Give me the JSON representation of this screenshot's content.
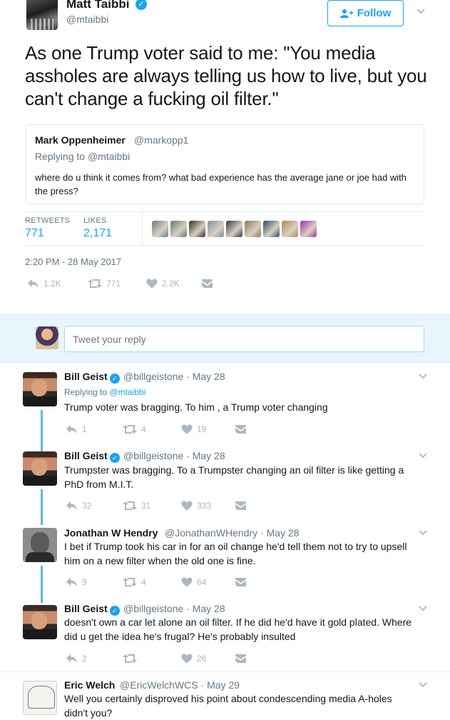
{
  "main": {
    "author_name": "Matt Taibbi",
    "author_handle": "@mtaibbi",
    "follow_label": "Follow",
    "text": "As one Trump voter said to me: \"You media assholes are always telling us how to live, but you can't change a fucking oil filter.\"",
    "quote": {
      "name": "Mark Oppenheimer",
      "handle": "@markopp1",
      "replying_prefix": "Replying to",
      "replying_handle": "@mtaibbi",
      "text": "where do u think it comes from? what bad experience has the average jane or joe had with the press?"
    },
    "stats": {
      "retweets_label": "RETWEETS",
      "retweets_value": "771",
      "likes_label": "LIKES",
      "likes_value": "2,171",
      "liker_colors": [
        "#6b7a8a",
        "#5b7f6a",
        "#3a2a22",
        "#7a8f9e",
        "#2c3a4a",
        "#8a7a50",
        "#2b4a6a",
        "#b08850",
        "#9b2fb0"
      ]
    },
    "timestamp": "2:20 PM - 28 May 2017",
    "actions": {
      "replies": "1.2K",
      "retweets": "771",
      "likes": "2.2K"
    }
  },
  "reply_box": {
    "placeholder": "Tweet your reply"
  },
  "replies": [
    {
      "name": "Bill Geist",
      "handle": "@billgeistone",
      "date": "May 28",
      "replying_prefix": "Replying to",
      "replying_handle": "@mtaibbi",
      "text": "Trump voter was bragging. To him ,  a Trump voter changing",
      "replies": "1",
      "retweets": "4",
      "likes": "19"
    },
    {
      "name": "Bill Geist",
      "handle": "@billgeistone",
      "date": "May 28",
      "text": "Trumpster was bragging. To a Trumpster changing an oil filter is like getting a PhD from M.I.T.",
      "replies": "32",
      "retweets": "31",
      "likes": "333"
    },
    {
      "name": "Jonathan W Hendry",
      "handle": "@JonathanWHendry",
      "date": "May 28",
      "text": "I bet if Trump took his car in for an oil change he'd tell them not to try to upsell him on a new filter when the old one is fine.",
      "replies": "9",
      "retweets": "4",
      "likes": "64"
    },
    {
      "name": "Bill Geist",
      "handle": "@billgeistone",
      "date": "May 28",
      "text": "doesn't own a car let alone an oil filter. If he did he'd have it gold plated. Where did u get the idea he's frugal? He's probably insulted",
      "replies": "2",
      "retweets": "",
      "likes": "26"
    },
    {
      "name": "Eric Welch",
      "handle": "@EricWelchWCS",
      "date": "May 29",
      "text": "Well you certainly disproved his point about condescending media A-holes didn't you?"
    }
  ]
}
